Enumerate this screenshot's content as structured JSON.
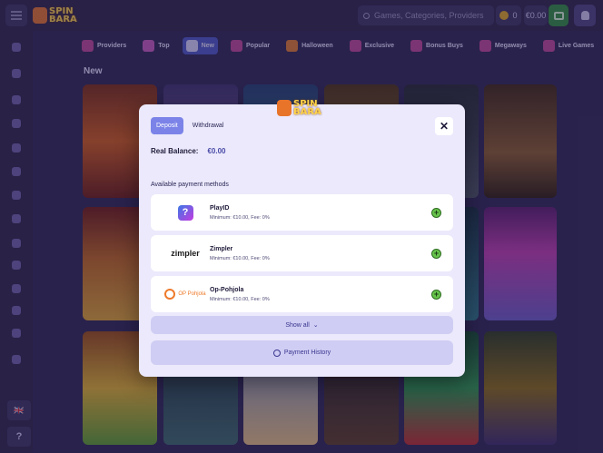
{
  "logo": {
    "line1": "SPIN",
    "line2": "BARA"
  },
  "header": {
    "search_placeholder": "Games, Categories, Providers",
    "coins": "0",
    "balance": "€0.00"
  },
  "categories": [
    {
      "label": "Providers",
      "color": "#c0449a"
    },
    {
      "label": "Top",
      "color": "#c85ac0"
    },
    {
      "label": "New",
      "color": "#d9d5ff"
    },
    {
      "label": "Popular",
      "color": "#c0449a"
    },
    {
      "label": "Halloween",
      "color": "#e07a2a"
    },
    {
      "label": "Exclusive",
      "color": "#c0449a"
    },
    {
      "label": "Bonus Buys",
      "color": "#c0449a"
    },
    {
      "label": "Megaways",
      "color": "#c0449a"
    },
    {
      "label": "Live Games",
      "color": "#c0449a"
    }
  ],
  "section_title": "New",
  "flag_label": "🇬🇧",
  "help_label": "?",
  "modal": {
    "tabs": [
      "Deposit",
      "Withdrawal"
    ],
    "balance_label": "Real Balance:",
    "balance_value": "€0.00",
    "methods_title": "Available payment methods",
    "methods": [
      {
        "name": "PlayID",
        "meta": "Minimum: €10.00, Fee: 0%",
        "logo": "playid-logo"
      },
      {
        "name": "Zimpler",
        "meta": "Minimum: €10.00, Fee: 0%",
        "logo_text": "zimpler"
      },
      {
        "name": "Op-Pohjola",
        "meta": "Minimum: €10.00, Fee: 0%",
        "logo_text": "OP Pohjola"
      }
    ],
    "show_all": "Show all",
    "payment_history": "Payment History"
  },
  "colors": {
    "accent": "#7b83e8",
    "add": "#66c34a",
    "page_bg": "#2b2452"
  }
}
